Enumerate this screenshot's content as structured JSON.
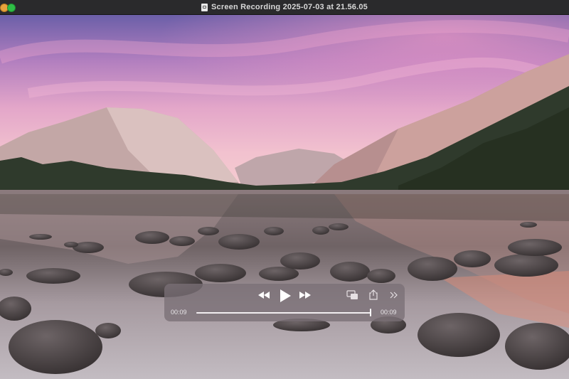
{
  "window": {
    "title": "Screen Recording 2025-07-03 at 21.56.05"
  },
  "player": {
    "elapsed": "00:09",
    "remaining": "00:09",
    "progress_fraction": 0.999,
    "buttons": {
      "rewind_icon": "rewind-icon",
      "play_icon": "play-icon",
      "fast_forward_icon": "fast-forward-icon",
      "pip_icon": "picture-in-picture-icon",
      "share_icon": "share-icon",
      "more_icon": "double-chevron-right-icon"
    }
  },
  "colors": {
    "close_button": "#e8a33d",
    "maximize_button": "#2fbe46",
    "titlebar": "#2a2a2c"
  }
}
